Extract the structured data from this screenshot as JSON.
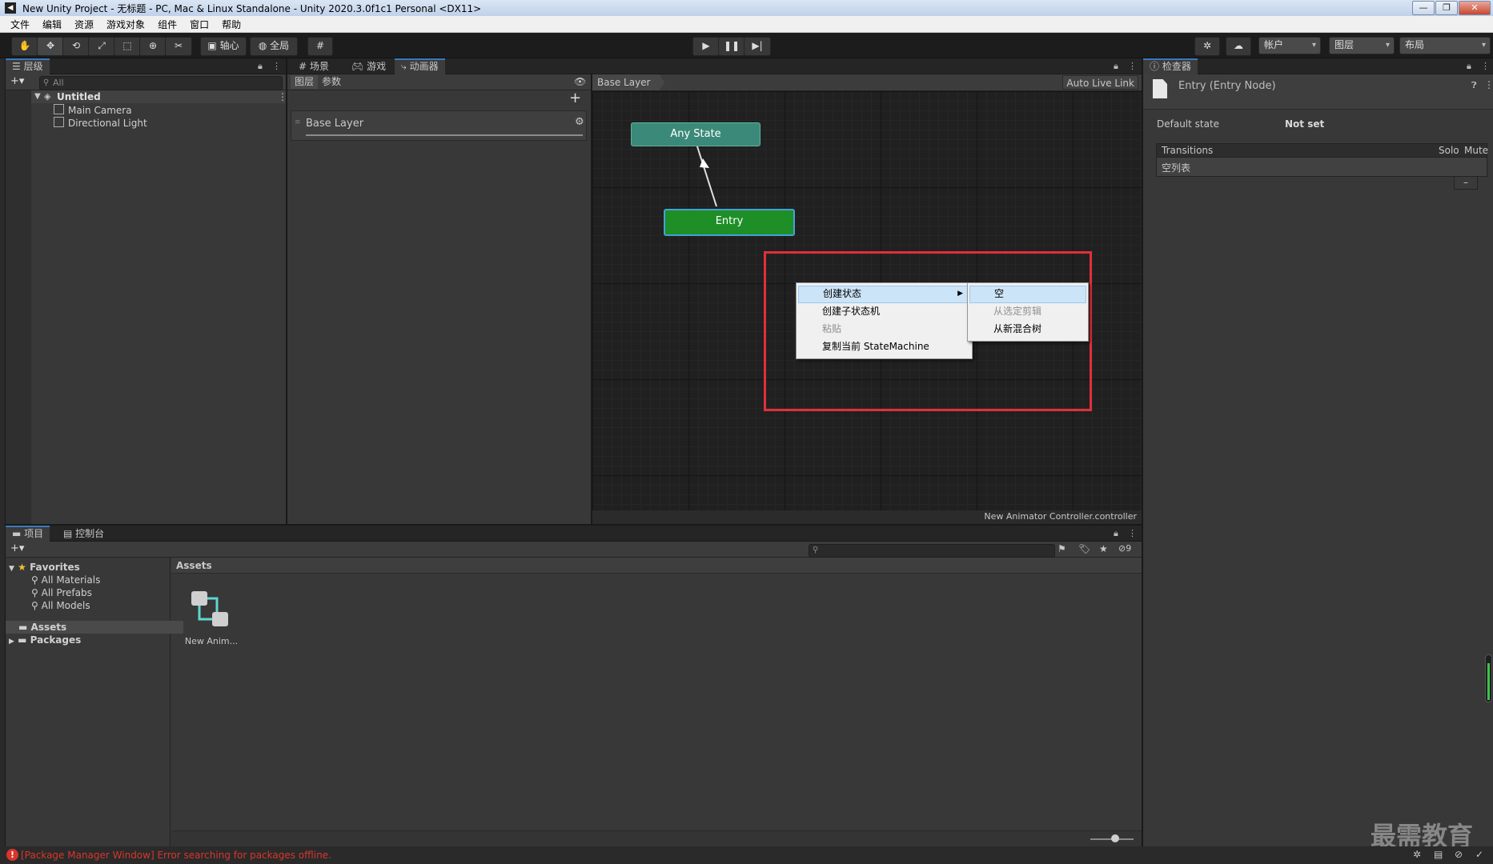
{
  "window": {
    "title": "New Unity Project - 无标题 - PC, Mac & Linux Standalone - Unity 2020.3.0f1c1 Personal <DX11>",
    "minimize": "—",
    "restore": "❐",
    "close": "✕"
  },
  "menu": [
    "文件",
    "编辑",
    "资源",
    "游戏对象",
    "组件",
    "窗口",
    "帮助"
  ],
  "toolbar": {
    "pivot": "轴心",
    "global": "全局",
    "account": "帐户",
    "layers": "图层",
    "layout": "布局"
  },
  "hierarchy": {
    "tab": "层级",
    "search_placeholder": "All",
    "scene": "Untitled",
    "items": [
      "Main Camera",
      "Directional Light"
    ]
  },
  "center_tabs": [
    "场景",
    "游戏",
    "动画器"
  ],
  "animator": {
    "subtabs": [
      "图层",
      "参数"
    ],
    "breadcrumb": "Base Layer",
    "auto_live_link": "Auto Live Link",
    "layer_name": "Base Layer",
    "footer": "New Animator Controller.controller",
    "nodes": {
      "any_state": "Any State",
      "entry": "Entry"
    }
  },
  "context_menu": {
    "items": [
      {
        "label": "创建状态",
        "state": "highlighted",
        "submenu": true
      },
      {
        "label": "创建子状态机",
        "state": "normal"
      },
      {
        "label": "粘贴",
        "state": "disabled"
      },
      {
        "label": "复制当前 StateMachine",
        "state": "normal"
      }
    ],
    "submenu": [
      {
        "label": "空",
        "state": "highlighted"
      },
      {
        "label": "从选定剪辑",
        "state": "disabled"
      },
      {
        "label": "从新混合树",
        "state": "normal"
      }
    ]
  },
  "inspector": {
    "tab": "检查器",
    "header": "Entry (Entry Node)",
    "default_state_label": "Default state",
    "default_state_value": "Not set",
    "transitions_label": "Transitions",
    "solo": "Solo",
    "mute": "Mute",
    "empty_list": "空列表",
    "remove": "–"
  },
  "project": {
    "tabs": [
      "项目",
      "控制台"
    ],
    "hidden_count": "9",
    "favorites": "Favorites",
    "favorite_items": [
      "All Materials",
      "All Prefabs",
      "All Models"
    ],
    "folders": [
      "Assets",
      "Packages"
    ],
    "assets_header": "Assets",
    "asset_label": "New Anim..."
  },
  "status": {
    "error": "[Package Manager Window] Error searching for packages offline."
  },
  "watermark": "最需教育",
  "colors": {
    "any_state": "#3b8a79",
    "entry": "#1e8f27",
    "highlight_box": "#e0303a",
    "accent_blue": "#3a79bb",
    "error_red": "#d8362c"
  }
}
